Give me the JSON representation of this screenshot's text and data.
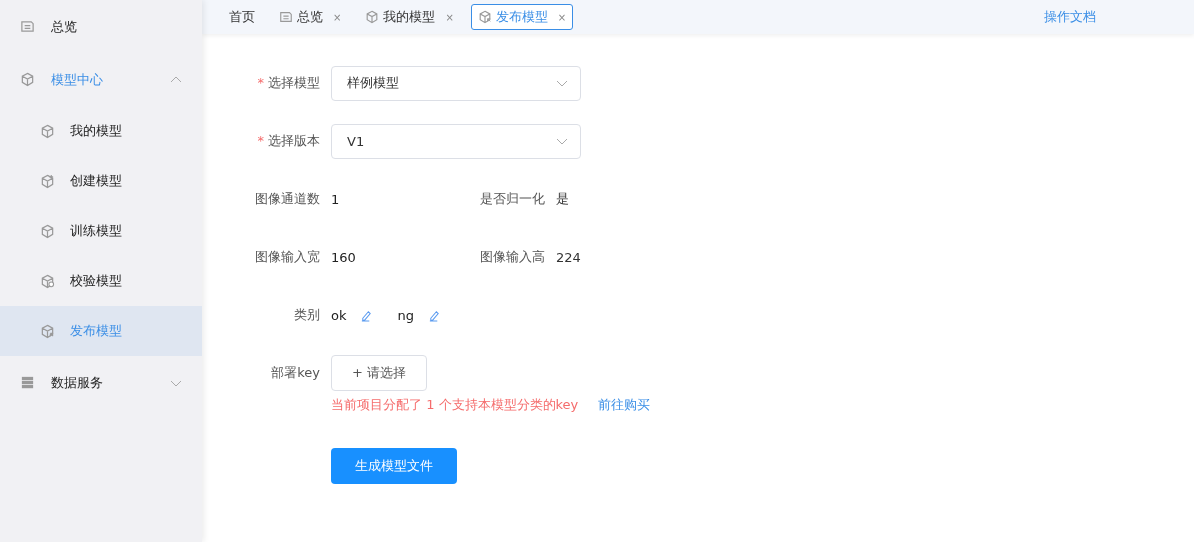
{
  "sidebar": {
    "items": [
      {
        "label": "总览",
        "kind": "overview",
        "selected": false
      },
      {
        "label": "模型中心",
        "kind": "cube",
        "selected": false,
        "expanded": true,
        "children": [
          {
            "label": "我的模型",
            "kind": "cube",
            "selected": false
          },
          {
            "label": "创建模型",
            "kind": "cube-plus",
            "selected": false
          },
          {
            "label": "训练模型",
            "kind": "cube",
            "selected": false
          },
          {
            "label": "校验模型",
            "kind": "cube-check",
            "selected": false
          },
          {
            "label": "发布模型",
            "kind": "cube-arrow",
            "selected": true
          }
        ]
      },
      {
        "label": "数据服务",
        "kind": "database",
        "selected": false,
        "expanded": false
      }
    ]
  },
  "tabs": [
    {
      "label": "首页",
      "kind": "plain",
      "selected": false
    },
    {
      "label": "总览",
      "kind": "overview",
      "close": "×",
      "selected": false
    },
    {
      "label": "我的模型",
      "kind": "cube",
      "close": "×",
      "selected": false
    },
    {
      "label": "发布模型",
      "kind": "cube-arrow",
      "close": "×",
      "selected": true
    }
  ],
  "docs_link": "操作文档",
  "form": {
    "selects": [
      {
        "label": "选择模型",
        "required": true,
        "required_mark": "*",
        "value": "样例模型"
      },
      {
        "label": "选择版本",
        "required": true,
        "required_mark": "*",
        "value": "V1"
      }
    ],
    "info_rows": [
      [
        {
          "label": "图像通道数",
          "value": "1"
        },
        {
          "label": "是否归一化",
          "value": "是"
        }
      ],
      [
        {
          "label": "图像输入宽",
          "value": "160"
        },
        {
          "label": "图像输入高",
          "value": "224"
        }
      ]
    ],
    "categories": {
      "label": "类别",
      "items": [
        "ok",
        "ng"
      ]
    },
    "deploy_key": {
      "label": "部署key",
      "button": "请选择",
      "plus": "+"
    },
    "notice": "当前项目分配了 1 个支持本模型分类的key",
    "buy_link": "前往购买",
    "submit": "生成模型文件"
  }
}
